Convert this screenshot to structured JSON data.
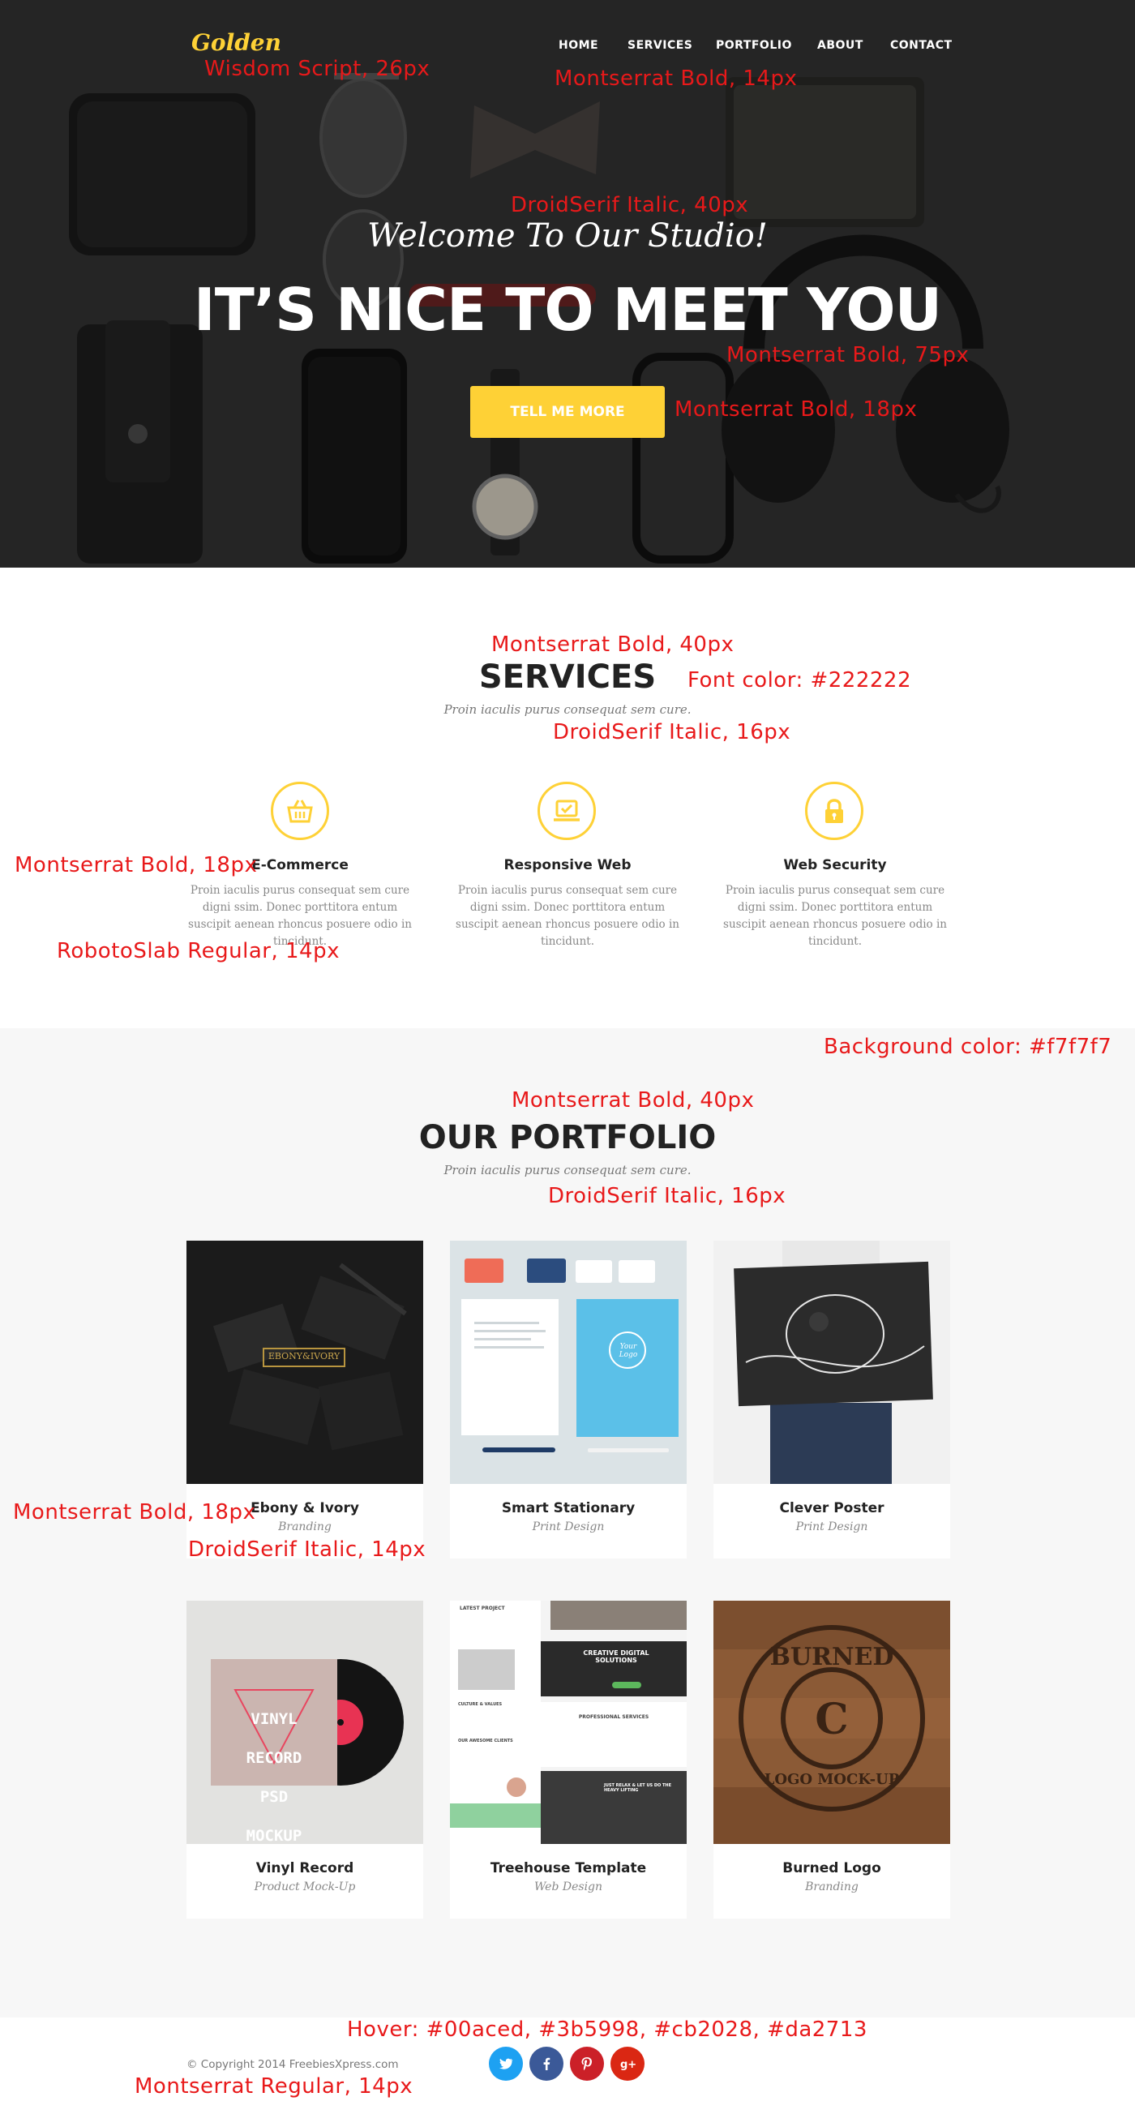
{
  "header": {
    "brand": "Golden",
    "nav": [
      "HOME",
      "SERVICES",
      "PORTFOLIO",
      "ABOUT",
      "CONTACT"
    ]
  },
  "hero": {
    "welcome": "Welcome To Our Studio!",
    "headline": "IT’S NICE TO MEET YOU",
    "cta": "TELL ME MORE"
  },
  "services": {
    "title": "SERVICES",
    "subtitle": "Proin iaculis purus consequat sem cure.",
    "items": [
      {
        "title": "E-Commerce",
        "icon": "shopping-basket-icon",
        "text": "Proin iaculis purus consequat sem cure digni ssim. Donec porttitora entum suscipit aenean rhoncus posuere odio in tincidunt."
      },
      {
        "title": "Responsive Web",
        "icon": "laptop-check-icon",
        "text": "Proin iaculis purus consequat sem cure digni ssim. Donec porttitora entum suscipit aenean rhoncus posuere odio in tincidunt."
      },
      {
        "title": "Web Security",
        "icon": "lock-icon",
        "text": "Proin iaculis purus consequat sem cure digni ssim. Donec porttitora entum suscipit aenean rhoncus posuere odio in tincidunt."
      }
    ]
  },
  "portfolio": {
    "title": "OUR PORTFOLIO",
    "subtitle": "Proin iaculis purus consequat sem cure.",
    "items": [
      {
        "title": "Ebony & Ivory",
        "category": "Branding",
        "image_text": "EBONY&IVORY"
      },
      {
        "title": "Smart Stationary",
        "category": "Print Design",
        "image_text": "Your Logo"
      },
      {
        "title": "Clever Poster",
        "category": "Print Design"
      },
      {
        "title": "Vinyl Record",
        "category": "Product Mock-Up",
        "image_text": [
          "VINYL",
          "RECORD",
          "PSD",
          "MOCKUP"
        ]
      },
      {
        "title": "Treehouse Template",
        "category": "Web Design",
        "image_text": [
          "LATEST PROJECT",
          "CREATIVE DIGITAL SOLUTIONS",
          "PROFESSIONAL SERVICES",
          "CULTURE & VALUES",
          "OUR AWESOME CLIENTS",
          "JUST RELAX & LET US DO THE HEAVY LIFTING"
        ]
      },
      {
        "title": "Burned Logo",
        "category": "Branding",
        "image_text": [
          "BURNED",
          "C",
          "LOGO MOCK-UP"
        ]
      }
    ]
  },
  "footer": {
    "copyright": "© Copyright 2014 FreebiesXpress.com",
    "social": [
      {
        "name": "twitter-icon",
        "color": "#1da1f2"
      },
      {
        "name": "facebook-icon",
        "color": "#3b5998"
      },
      {
        "name": "pinterest-icon",
        "color": "#cb2028"
      },
      {
        "name": "google-plus-icon",
        "color": "#da2713"
      }
    ]
  },
  "annotations": {
    "logo_font": "Wisdom Script, 26px",
    "nav_font": "Montserrat Bold, 14px",
    "welcome_font": "DroidSerif Italic, 40px",
    "headline_font": "Montserrat Bold, 75px",
    "cta_font": "Montserrat Bold, 18px",
    "services_title_font": "Montserrat Bold, 40px",
    "services_color": "Font color: #222222",
    "services_sub_font": "DroidSerif Italic, 16px",
    "svc_title_font": "Montserrat Bold, 18px",
    "svc_text_font": "RobotoSlab Regular, 14px",
    "portfolio_bg": "Background color: #f7f7f7",
    "portfolio_title_font": "Montserrat Bold, 40px",
    "portfolio_sub_font": "DroidSerif Italic, 16px",
    "card_title_font": "Montserrat Bold, 18px",
    "card_cat_font": "DroidSerif Italic, 14px",
    "hover_colors": "Hover: #00aced, #3b5998, #cb2028, #da2713",
    "footer_font": "Montserrat Regular, 14px"
  },
  "colors": {
    "accent": "#fed136",
    "heading": "#222222",
    "portfolio_bg": "#f7f7f7",
    "annotation": "#e8191a"
  }
}
